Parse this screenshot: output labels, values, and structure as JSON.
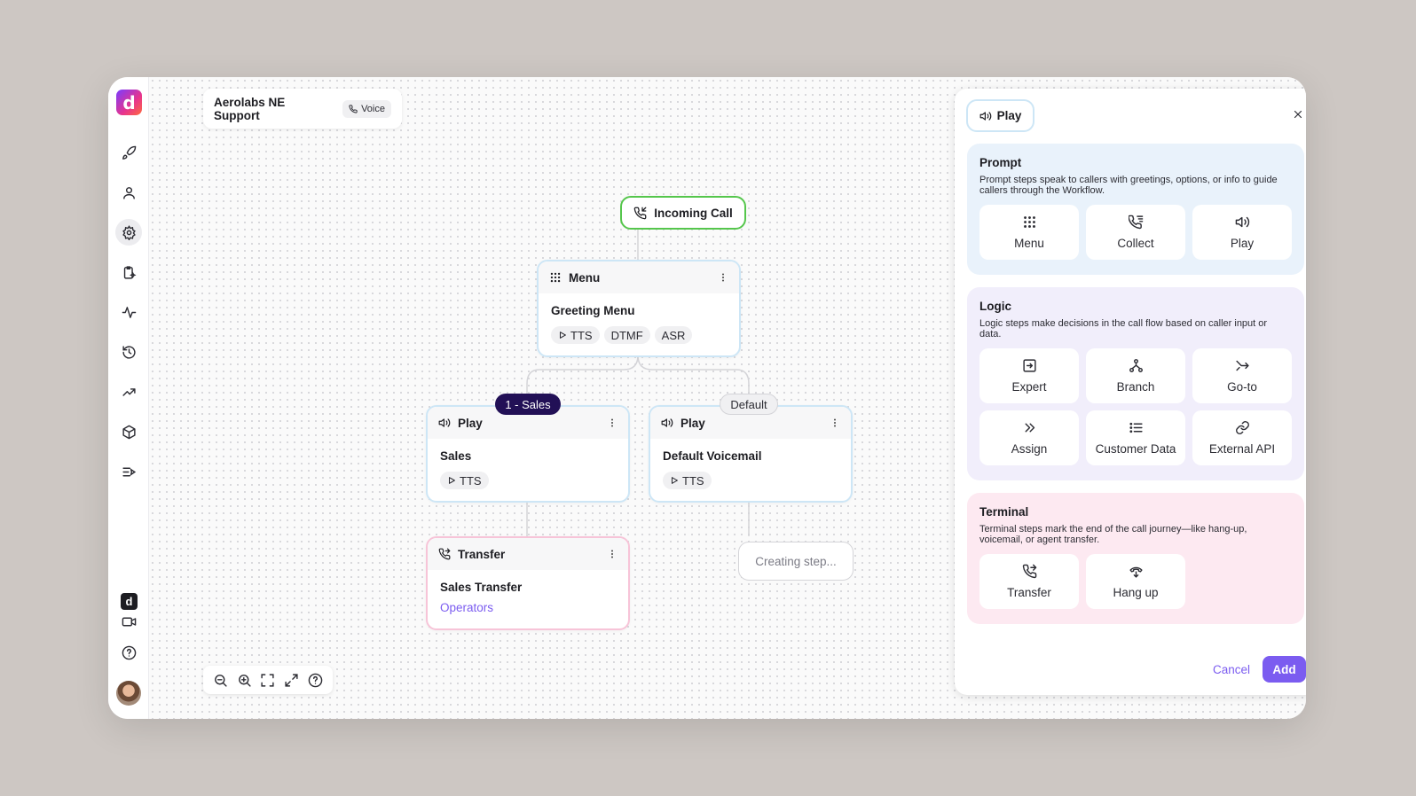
{
  "app": {
    "workflow_title": "Aerolabs NE Support",
    "channel_badge": "Voice",
    "brand_color": "#7b5cf0",
    "sidebar_icons": [
      "rocket-icon",
      "user-icon",
      "gear-icon",
      "clipboard-sparkle-icon",
      "activity-icon",
      "history-icon",
      "trending-up-icon",
      "cube-icon",
      "list-send-icon",
      "logo-small-icon",
      "video-icon",
      "help-icon",
      "avatar"
    ]
  },
  "flow": {
    "incoming": {
      "label": "Incoming Call"
    },
    "menu_node": {
      "type": "Menu",
      "title": "Greeting Menu",
      "tags": [
        "TTS",
        "DTMF",
        "ASR"
      ]
    },
    "edge_sales": "1 - Sales",
    "edge_default": "Default",
    "play_sales": {
      "type": "Play",
      "title": "Sales",
      "tags": [
        "TTS"
      ]
    },
    "play_default": {
      "type": "Play",
      "title": "Default Voicemail",
      "tags": [
        "TTS"
      ]
    },
    "transfer_node": {
      "type": "Transfer",
      "title": "Sales Transfer",
      "target": "Operators"
    },
    "creating": "Creating step..."
  },
  "panel": {
    "selected": "Play",
    "prompt": {
      "title": "Prompt",
      "description": "Prompt steps speak to callers with greetings, options, or info to guide callers through the Workflow.",
      "options": [
        "Menu",
        "Collect",
        "Play"
      ]
    },
    "logic": {
      "title": "Logic",
      "description": "Logic steps make decisions in the call flow based on caller input or data.",
      "options": [
        "Expert",
        "Branch",
        "Go-to",
        "Assign",
        "Customer Data",
        "External API"
      ]
    },
    "terminal": {
      "title": "Terminal",
      "description": "Terminal steps mark the end of the call journey—like hang-up, voicemail, or agent transfer.",
      "options": [
        "Transfer",
        "Hang up"
      ]
    },
    "cancel_label": "Cancel",
    "add_label": "Add"
  }
}
